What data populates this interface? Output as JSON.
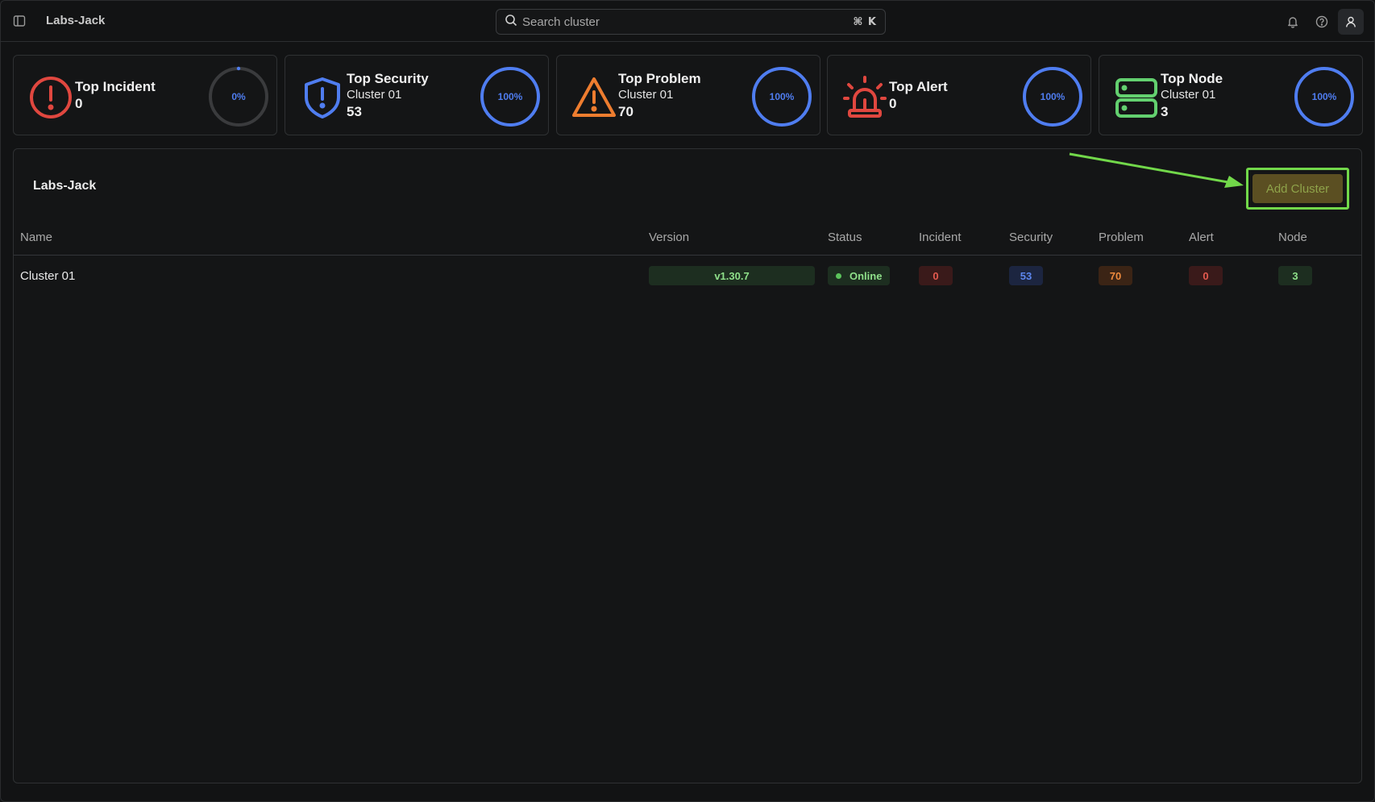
{
  "app": {
    "workspace_title": "Labs-Jack",
    "search": {
      "placeholder": "Search cluster",
      "shortcut": "⌘ K"
    },
    "icons": [
      "sidebar-toggle-icon",
      "bell-icon",
      "help-icon",
      "user-icon"
    ]
  },
  "cards": [
    {
      "title": "Top Incident",
      "subtitle": "",
      "value": "0",
      "percent_label": "0%",
      "percent": 0,
      "icon": "alert-circle-icon",
      "color": "#e0473f"
    },
    {
      "title": "Top Security",
      "subtitle": "Cluster 01",
      "value": "53",
      "percent_label": "100%",
      "percent": 100,
      "icon": "shield-alert-icon",
      "color": "#4f7df0"
    },
    {
      "title": "Top Problem",
      "subtitle": "Cluster 01",
      "value": "70",
      "percent_label": "100%",
      "percent": 100,
      "icon": "warning-triangle-icon",
      "color": "#ee7d2f"
    },
    {
      "title": "Top Alert",
      "subtitle": "",
      "value": "0",
      "percent_label": "100%",
      "percent": 100,
      "icon": "siren-icon",
      "color": "#e0473f"
    },
    {
      "title": "Top Node",
      "subtitle": "Cluster 01",
      "value": "3",
      "percent_label": "100%",
      "percent": 100,
      "icon": "server-icon",
      "color": "#63d06f"
    }
  ],
  "panel": {
    "title": "Labs-Jack",
    "add_button_label": "Add Cluster",
    "columns": [
      "Name",
      "Version",
      "Status",
      "Incident",
      "Security",
      "Problem",
      "Alert",
      "Node"
    ],
    "rows": [
      {
        "name": "Cluster 01",
        "version": "v1.30.7",
        "status": "Online",
        "incident": "0",
        "security": "53",
        "problem": "70",
        "alert": "0",
        "node": "3"
      }
    ]
  },
  "colors": {
    "background": "#121314",
    "ring_accent": "#4f7df0",
    "ring_track": "#3a3b3d",
    "annotation": "#72d84a",
    "add_button_bg": "#5b4f22"
  }
}
